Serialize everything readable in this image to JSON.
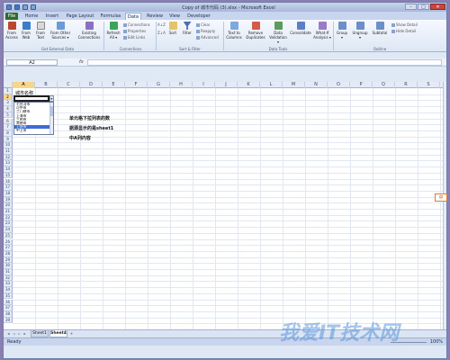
{
  "window": {
    "title": "Copy of 城市代码 (3).xlsx - Microsoft Excel",
    "minimize": "–",
    "maximize": "□",
    "close": "✕"
  },
  "tabs": [
    {
      "label": "File"
    },
    {
      "label": "Home"
    },
    {
      "label": "Insert"
    },
    {
      "label": "Page Layout"
    },
    {
      "label": "Formulas"
    },
    {
      "label": "Data"
    },
    {
      "label": "Review"
    },
    {
      "label": "View"
    },
    {
      "label": "Developer"
    }
  ],
  "ribbon": {
    "groups": {
      "external": "Get External Data",
      "connections": "Connections",
      "sortfilter": "Sort & Filter",
      "datatools": "Data Tools",
      "outline": "Outline"
    },
    "from_access": "From\nAccess",
    "from_web": "From\nWeb",
    "from_text": "From\nText",
    "from_other": "From Other\nSources ▾",
    "existing": "Existing\nConnections",
    "refresh": "Refresh\nAll ▾",
    "connections": "Connections",
    "properties": "Properties",
    "edit_links": "Edit Links",
    "sort": "Sort",
    "filter": "Filter",
    "clear": "Clear",
    "reapply": "Reapply",
    "advanced": "Advanced",
    "text_to_columns": "Text to\nColumns",
    "remove_dup": "Remove\nDuplicates",
    "data_validation": "Data\nValidation ▾",
    "consolidate": "Consolidate",
    "whatif": "What-If\nAnalysis ▾",
    "group": "Group\n▾",
    "ungroup": "Ungroup\n▾",
    "subtotal": "Subtotal",
    "show_detail": "Show Detail",
    "hide_detail": "Hide Detail"
  },
  "formula_bar": {
    "name_box": "A2",
    "fx": "fx",
    "value": ""
  },
  "columns": [
    "A",
    "B",
    "C",
    "D",
    "E",
    "F",
    "G",
    "H",
    "I",
    "J",
    "K",
    "L",
    "M",
    "N",
    "O",
    "P",
    "Q",
    "R",
    "S"
  ],
  "rows": [
    "1",
    "2",
    "3",
    "4",
    "5",
    "6",
    "7",
    "8",
    "9",
    "10",
    "11",
    "12",
    "13",
    "14",
    "15",
    "16",
    "17",
    "18",
    "19",
    "20",
    "21",
    "22",
    "23",
    "24",
    "25",
    "26",
    "27",
    "28",
    "29",
    "30",
    "31",
    "32",
    "33",
    "34",
    "35",
    "36",
    "37",
    "38",
    "39"
  ],
  "cells": {
    "a1": "城市名称"
  },
  "dropdown": {
    "options": [
      "七台河市",
      "可中市",
      "三门峡市",
      "上海市",
      "三明市",
      "常德市",
      "上饶市",
      "中卫市"
    ],
    "selected_index": 6
  },
  "notes": {
    "line1": "单元格下拉列表的数",
    "line2": "据源显示的是sheet1",
    "line3": "中A列内容"
  },
  "sheets": [
    {
      "label": "Sheet1"
    },
    {
      "label": "Sheet4"
    }
  ],
  "active_sheet": 1,
  "status": {
    "ready": "Ready",
    "zoom": "100%"
  },
  "ime": "中",
  "watermark": "我爱IT技术网"
}
